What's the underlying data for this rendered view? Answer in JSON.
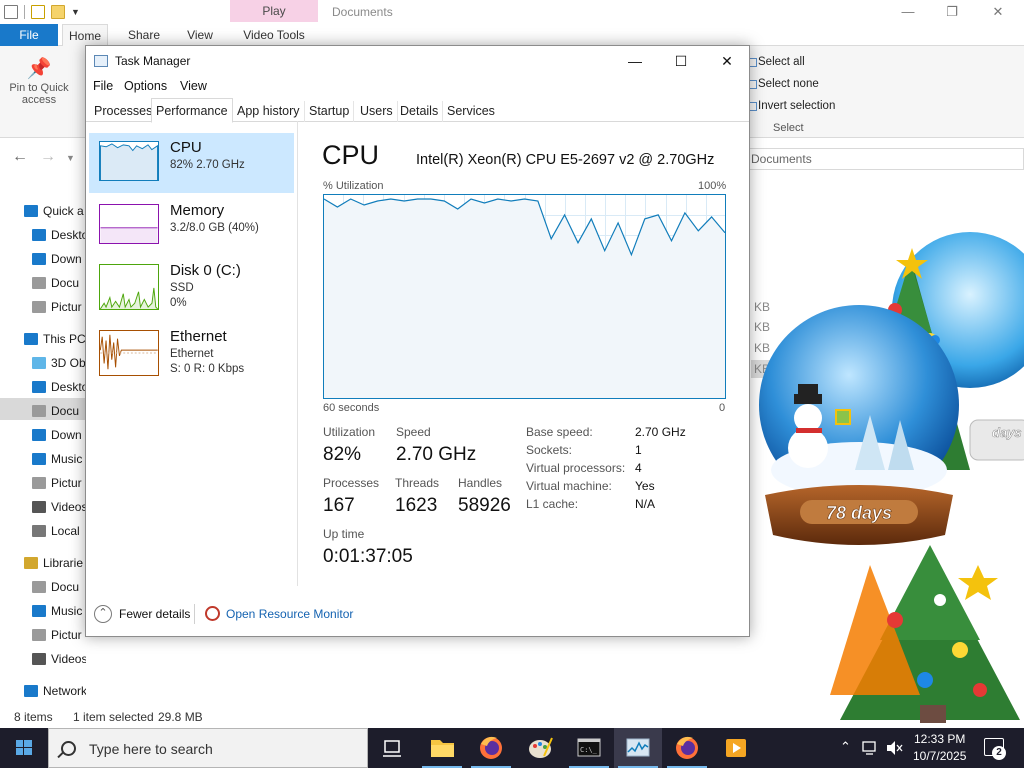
{
  "explorer": {
    "context_tab": "Play",
    "window_title": "Documents",
    "ribbon_tabs": {
      "file": "File",
      "home": "Home",
      "share": "Share",
      "view": "View",
      "video_tools": "Video Tools"
    },
    "pin_label": "Pin to Quick access",
    "select_group": {
      "select_all": "Select all",
      "select_none": "Select none",
      "invert_selection": "Invert selection",
      "caption": "Select"
    },
    "address": "Documents",
    "nav_items": [
      "Quick a",
      "Deskto",
      "Down",
      "Docu",
      "Pictur",
      "This PC",
      "3D Ob",
      "Deskto",
      "Docu",
      "Down",
      "Music",
      "Pictur",
      "Videos",
      "Local",
      "Librarie",
      "Docu",
      "Music",
      "Pictur",
      "Videos",
      "Network"
    ],
    "kb_labels": [
      "KB",
      "KB",
      "KB",
      "KB"
    ],
    "status": {
      "items": "8 items",
      "selected": "1 item selected",
      "size": "29.8 MB"
    }
  },
  "decoration": {
    "countdown": "78 days",
    "countdown_small": "days"
  },
  "taskmgr": {
    "title": "Task Manager",
    "menu": {
      "file": "File",
      "options": "Options",
      "view": "View"
    },
    "tabs": [
      "Processes",
      "Performance",
      "App history",
      "Startup",
      "Users",
      "Details",
      "Services"
    ],
    "resources": {
      "cpu": {
        "name": "CPU",
        "line1": "82%  2.70 GHz"
      },
      "memory": {
        "name": "Memory",
        "line1": "3.2/8.0 GB (40%)"
      },
      "disk": {
        "name": "Disk 0 (C:)",
        "line1": "SSD",
        "line2": "0%"
      },
      "ethernet": {
        "name": "Ethernet",
        "line1": "Ethernet",
        "line2": "S: 0  R: 0 Kbps"
      }
    },
    "header": {
      "title": "CPU",
      "model": "Intel(R) Xeon(R) CPU E5-2697 v2 @ 2.70GHz"
    },
    "graph": {
      "ylabel": "% Utilization",
      "ymax_label": "100%",
      "xlabel": "60 seconds",
      "xmin_label": "0"
    },
    "stats": {
      "utilization_label": "Utilization",
      "utilization": "82%",
      "speed_label": "Speed",
      "speed": "2.70 GHz",
      "processes_label": "Processes",
      "processes": "167",
      "threads_label": "Threads",
      "threads": "1623",
      "handles_label": "Handles",
      "handles": "58926",
      "uptime_label": "Up time",
      "uptime": "0:01:37:05"
    },
    "specs": [
      {
        "label": "Base speed:",
        "value": "2.70 GHz"
      },
      {
        "label": "Sockets:",
        "value": "1"
      },
      {
        "label": "Virtual processors:",
        "value": "4"
      },
      {
        "label": "Virtual machine:",
        "value": "Yes"
      },
      {
        "label": "L1 cache:",
        "value": "N/A"
      }
    ],
    "footer": {
      "fewer_details": "Fewer details",
      "open_resource_monitor": "Open Resource Monitor"
    }
  },
  "chart_data": {
    "type": "line",
    "ylabel": "% Utilization",
    "ylim": [
      0,
      100
    ],
    "xlim": [
      60,
      0
    ],
    "x": [
      60,
      58,
      56,
      54,
      52,
      50,
      48,
      46,
      44,
      42,
      40,
      38,
      36,
      34,
      32,
      30,
      28,
      26,
      24,
      22,
      20,
      18,
      16,
      14,
      12,
      10,
      8,
      6,
      4,
      2,
      0
    ],
    "series": [
      {
        "values": [
          100,
          96,
          100,
          97,
          99,
          100,
          99,
          100,
          100,
          99,
          95,
          100,
          98,
          100,
          99,
          100,
          99,
          80,
          92,
          78,
          90,
          74,
          88,
          72,
          90,
          92,
          79,
          93,
          84,
          91,
          83
        ]
      }
    ]
  },
  "taskbar": {
    "search_placeholder": "Type here to search",
    "time": "12:33 PM",
    "date": "10/7/2025",
    "notification_count": "2"
  },
  "colors": {
    "cpu_line": "#117dbb",
    "cpu_fill": "#f1f6fa",
    "memory": "#8b12ae",
    "disk": "#4da60c",
    "ethernet": "#a74f01",
    "accent": "#1979ca"
  }
}
